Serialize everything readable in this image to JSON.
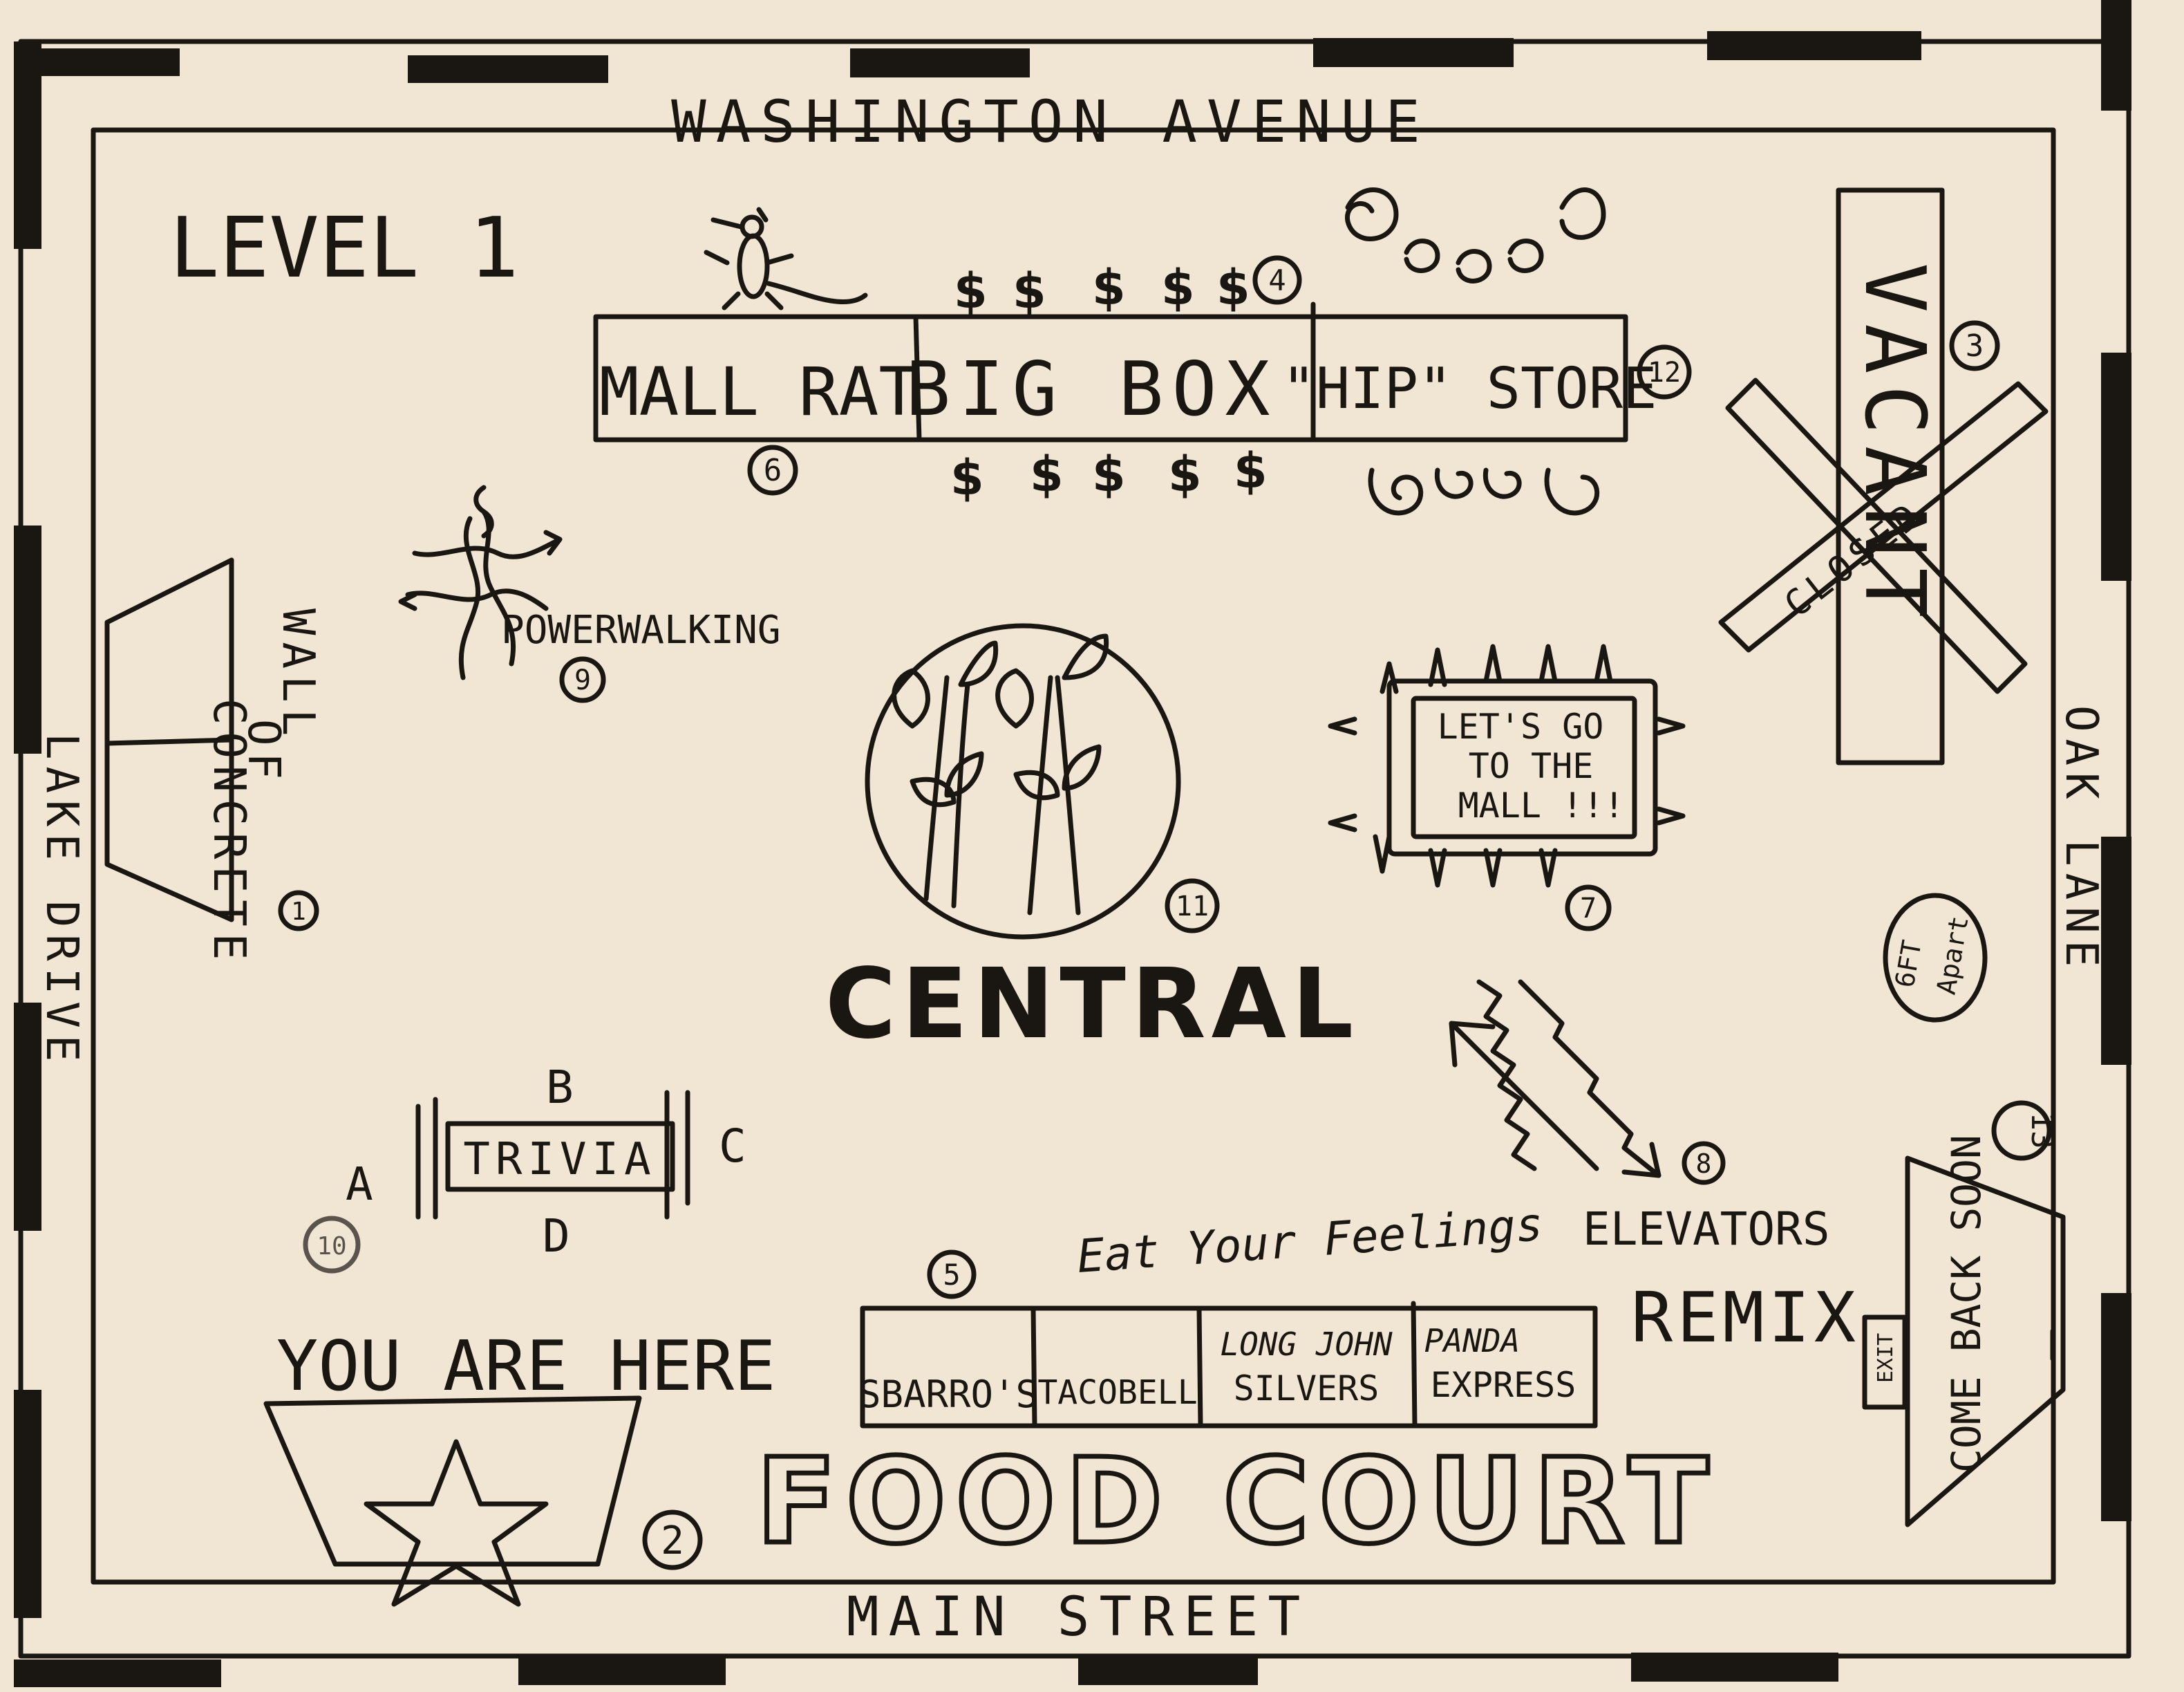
{
  "level": "LEVEL 1",
  "streets": {
    "north": "WASHINGTON AVENUE",
    "south": "MAIN STREET",
    "west": "LAKE DRIVE",
    "east": "OAK LANE"
  },
  "stores": {
    "mall_rat": "MALL RAT",
    "big_box": "BIG BOX",
    "hip_store": "\"HIP\" STORE",
    "vacant": "VACANT",
    "closed": "CLOSED"
  },
  "markers": {
    "m1": "1",
    "m2": "2",
    "m3": "3",
    "m4": "4",
    "m5": "5",
    "m6": "6",
    "m7": "7",
    "m8": "8",
    "m9": "9",
    "m10": "10",
    "m11": "11",
    "m12": "12",
    "m13": "13"
  },
  "labels": {
    "powerwalking": "POWERWALKING",
    "wall_line1": "WALL",
    "wall_line2": "OF",
    "wall_line3": "CONCRETE",
    "central": "CENTRAL",
    "sign_line1": "LET'S GO",
    "sign_line2": "TO THE",
    "sign_line3": "MALL !!!",
    "six_ft_line1": "6FT",
    "six_ft_line2": "Apart",
    "trivia": "TRIVIA",
    "trivia_a": "A",
    "trivia_b": "B",
    "trivia_c": "C",
    "trivia_d": "D",
    "elevators": "ELEVATORS",
    "remix": "REMIX",
    "eat_feelings": "Eat Your Feelings",
    "you_are_here": "YOU ARE HERE",
    "come_back_soon": "COME BACK SOON",
    "exit": "EXIT"
  },
  "food_court": {
    "title": "FOOD COURT",
    "restaurants": [
      "SBARRO'S",
      "TACOBELL",
      "LONG JOHN",
      "SILVERS",
      "PANDA",
      "EXPRESS"
    ]
  },
  "colors": {
    "paper": "#f1e6d3",
    "ink": "#1a1612"
  }
}
